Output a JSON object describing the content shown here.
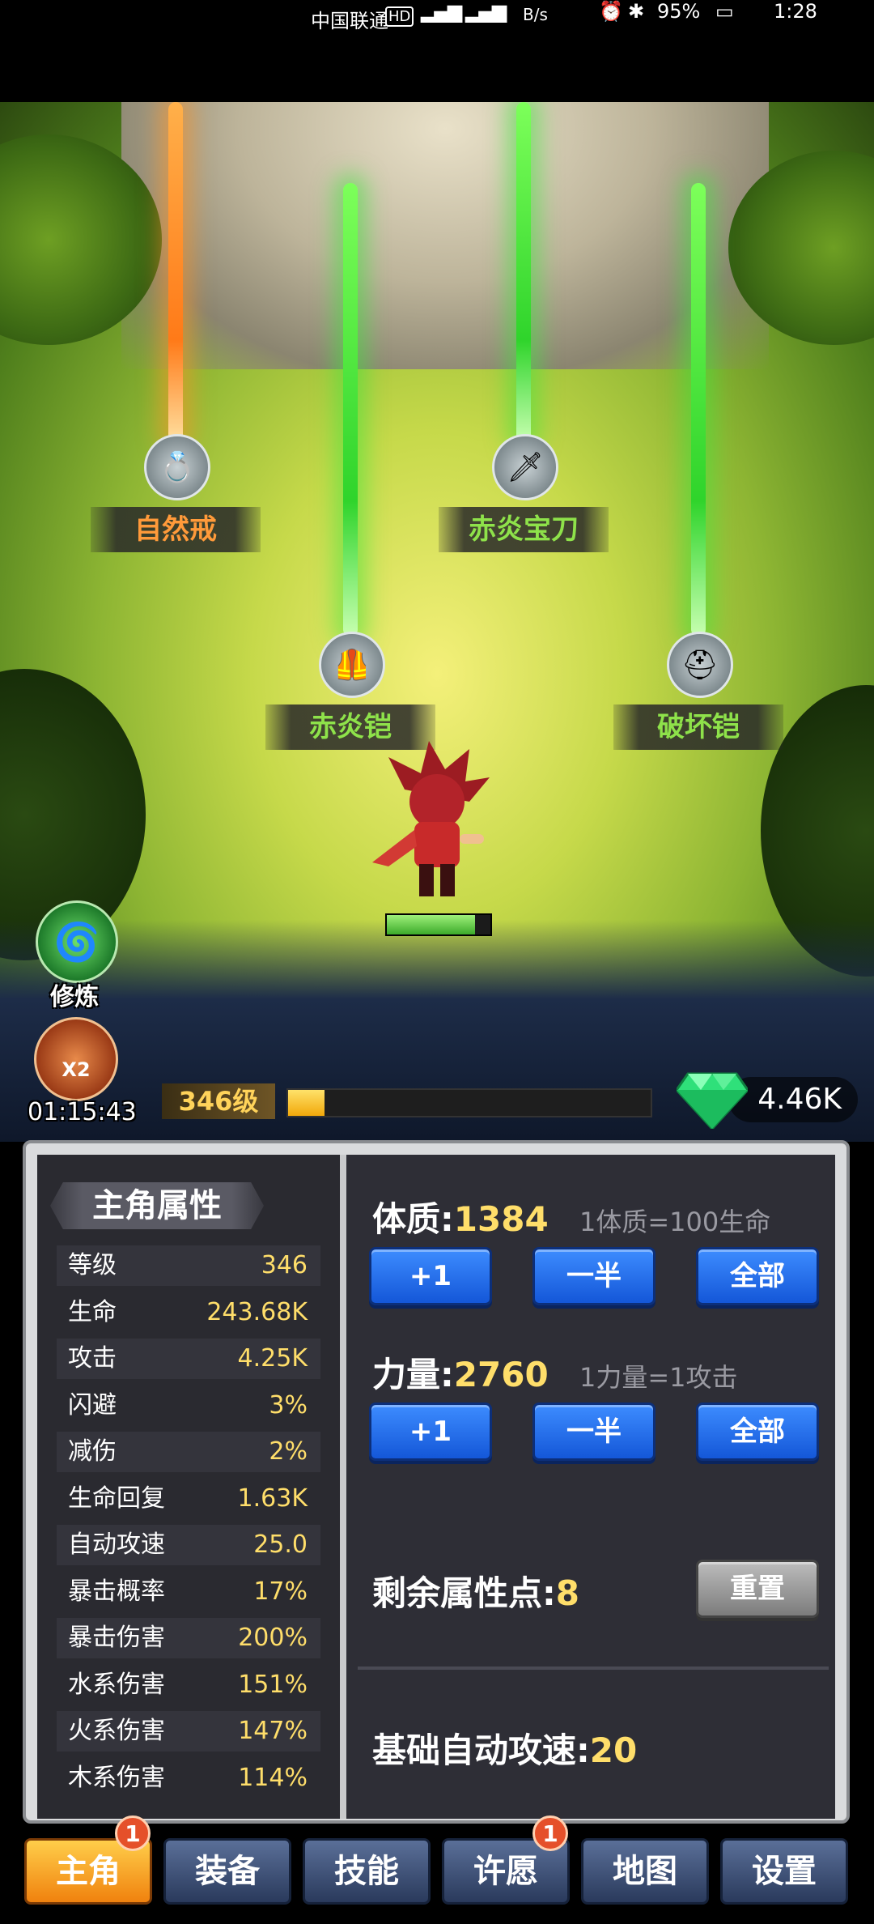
{
  "status_bar": {
    "carrier": "中国联通",
    "net_speed_unit": "B/s",
    "battery": "95%",
    "time": "1:28"
  },
  "field_items": [
    {
      "name": "自然戒",
      "glow": "orange",
      "icon": "ring-icon"
    },
    {
      "name": "赤炎宝刀",
      "glow": "green",
      "icon": "sword-icon"
    },
    {
      "name": "赤炎铠",
      "glow": "green",
      "icon": "armor-icon"
    },
    {
      "name": "破坏铠",
      "glow": "green",
      "icon": "helmet-armor-icon"
    }
  ],
  "side_buttons": {
    "cultivate_label": "修炼",
    "double_label": "X2",
    "double_timer": "01:15:43"
  },
  "player": {
    "level_label": "346级",
    "xp_progress": 0.1,
    "hp_progress": 0.85,
    "gems": "4.46K"
  },
  "attributes": {
    "title": "主角属性",
    "rows": [
      {
        "label": "等级",
        "value": "346"
      },
      {
        "label": "生命",
        "value": "243.68K"
      },
      {
        "label": "攻击",
        "value": "4.25K"
      },
      {
        "label": "闪避",
        "value": "3%"
      },
      {
        "label": "减伤",
        "value": "2%"
      },
      {
        "label": "生命回复",
        "value": "1.63K"
      },
      {
        "label": "自动攻速",
        "value": "25.0"
      },
      {
        "label": "暴击概率",
        "value": "17%"
      },
      {
        "label": "暴击伤害",
        "value": "200%"
      },
      {
        "label": "水系伤害",
        "value": "151%"
      },
      {
        "label": "火系伤害",
        "value": "147%"
      },
      {
        "label": "木系伤害",
        "value": "114%"
      }
    ]
  },
  "constitution": {
    "label": "体质:",
    "value": "1384",
    "hint": "1体质=100生命",
    "btn_plus": "+1",
    "btn_half": "一半",
    "btn_all": "全部"
  },
  "strength": {
    "label": "力量:",
    "value": "2760",
    "hint": "1力量=1攻击",
    "btn_plus": "+1",
    "btn_half": "一半",
    "btn_all": "全部"
  },
  "points": {
    "label": "剩余属性点:",
    "value": "8",
    "reset": "重置"
  },
  "base_speed": {
    "label": "基础自动攻速:",
    "value": "20"
  },
  "tabs": [
    {
      "label": "主角",
      "badge": "1",
      "active": true
    },
    {
      "label": "装备",
      "badge": "",
      "active": false
    },
    {
      "label": "技能",
      "badge": "",
      "active": false
    },
    {
      "label": "许愿",
      "badge": "1",
      "active": false
    },
    {
      "label": "地图",
      "badge": "",
      "active": false
    },
    {
      "label": "设置",
      "badge": "",
      "active": false
    }
  ],
  "colors": {
    "accent_gold": "#ffde6a",
    "button_blue": "#1457d8",
    "active_tab": "#f0820e",
    "beam_orange": "#ff7a18",
    "beam_green": "#2fd42b"
  }
}
